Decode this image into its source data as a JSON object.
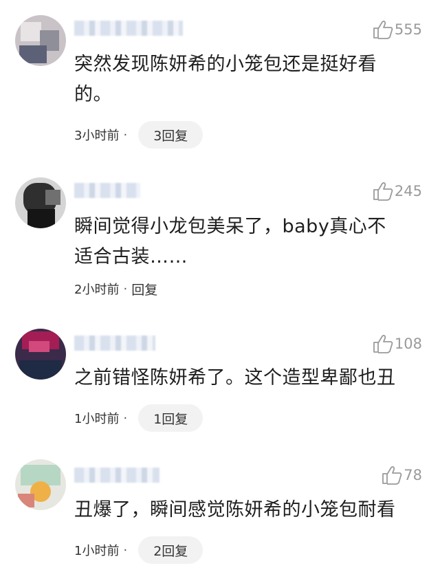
{
  "comments": [
    {
      "likes": "555",
      "text": "突然发现陈妍希的小笼包还是挺好看的。",
      "time": "3小时前",
      "reply": "3回复",
      "reply_style": "pill",
      "avatar_colors": [
        "#c9c3c8",
        "#8f8f9a",
        "#e8e4e6",
        "#5d6178"
      ]
    },
    {
      "likes": "245",
      "text": "瞬间觉得小龙包美呆了，baby真心不适合古装……",
      "time": "2小时前",
      "reply": "回复",
      "reply_style": "plain",
      "avatar_colors": [
        "#2f2f2f",
        "#707070",
        "#d5d5d5",
        "#151515"
      ]
    },
    {
      "likes": "108",
      "text": "之前错怪陈妍希了。这个造型卑鄙也丑",
      "time": "1小时前",
      "reply": "1回复",
      "reply_style": "pill",
      "avatar_colors": [
        "#a41d55",
        "#3b2a4a",
        "#d24a7d",
        "#1f2a44"
      ]
    },
    {
      "likes": "78",
      "text": "丑爆了，瞬间感觉陈妍希的小笼包耐看",
      "time": "1小时前",
      "reply": "2回复",
      "reply_style": "pill",
      "avatar_colors": [
        "#b6d7c3",
        "#f0b048",
        "#e7e7e1",
        "#d9857a"
      ]
    }
  ]
}
